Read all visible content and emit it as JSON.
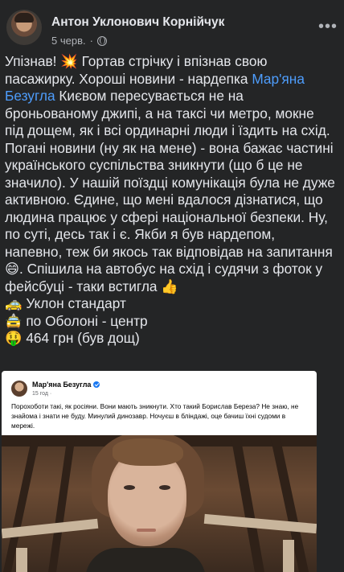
{
  "post": {
    "author": "Антон Уклонович Корнійчук",
    "date": "5 черв.",
    "dot": "·",
    "icons": {
      "privacy": "globe-icon",
      "more": "more-options-icon"
    },
    "paragraph": {
      "before_link": "Упізнав! 💥 Гортав стрічку і впізнав свою пасажирку. Хороші новини - нардепка ",
      "link": "Мар'яна Безугла",
      "after_link": " Києвом пересувається не на броньованому джипі, а на таксі чи метро, мокне під дощем, як і всі ординарні люди і їздить на схід. Погані новини (ну як на мене) - вона бажає частині українського суспільства зникнути (що б це не значило). У нашій поїздці комунікація була не дуже активною. Єдине, що мені вдалося дізнатися, що людина працює у сфері національної безпеки. Ну, по суті, десь так і є. Якби я був нардепом, напевно, теж би якось так відповідав на запитання 😄. Спішила на автобус на схід і судячи з фоток у фейсбуці - таки встигла 👍"
    },
    "lines": [
      "🚕 Уклон стандарт",
      "🚖 по Оболоні - центр",
      "🤑 464 грн (був дощ)"
    ]
  },
  "embed": {
    "name": "Мар'яна Безугла",
    "meta": "15 год ·",
    "text": "Порохоботи такі, як росіяни. Вони мають зникнути. Хто такий Борислав Береза? Не знаю, не знайома і знати не буду. Минулий динозавр. Ночуєш в бліндажі, оце бачиш їхні судоми в мережі."
  }
}
